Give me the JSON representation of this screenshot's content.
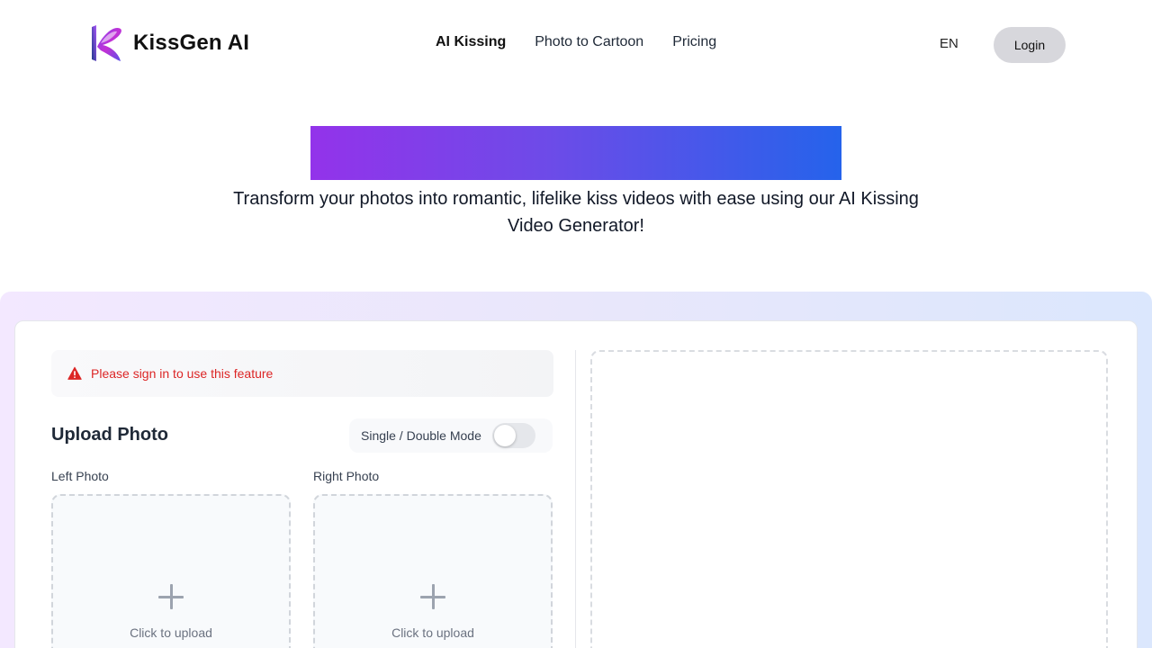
{
  "brand": {
    "name": "KissGen AI",
    "logo_icon": "kissgen-logo-icon"
  },
  "nav": {
    "items": [
      {
        "label": "AI Kissing",
        "active": true
      },
      {
        "label": "Photo to Cartoon",
        "active": false
      },
      {
        "label": "Pricing",
        "active": false
      }
    ]
  },
  "header": {
    "language": "EN",
    "login_label": "Login"
  },
  "hero": {
    "subtitle": "Transform your photos into romantic, lifelike kiss videos with ease using our AI Kissing Video Generator!",
    "gradient_colors": [
      "#9333ea",
      "#2563eb"
    ]
  },
  "alert": {
    "text": "Please sign in to use this feature",
    "icon": "warning-triangle-icon",
    "color": "#dc2626"
  },
  "upload": {
    "title": "Upload Photo",
    "mode_label": "Single / Double Mode",
    "mode_toggle_on": false,
    "left": {
      "label": "Left Photo",
      "cta": "Click to upload",
      "icon": "plus-icon"
    },
    "right": {
      "label": "Right Photo",
      "cta": "Click to upload",
      "icon": "plus-icon"
    }
  }
}
